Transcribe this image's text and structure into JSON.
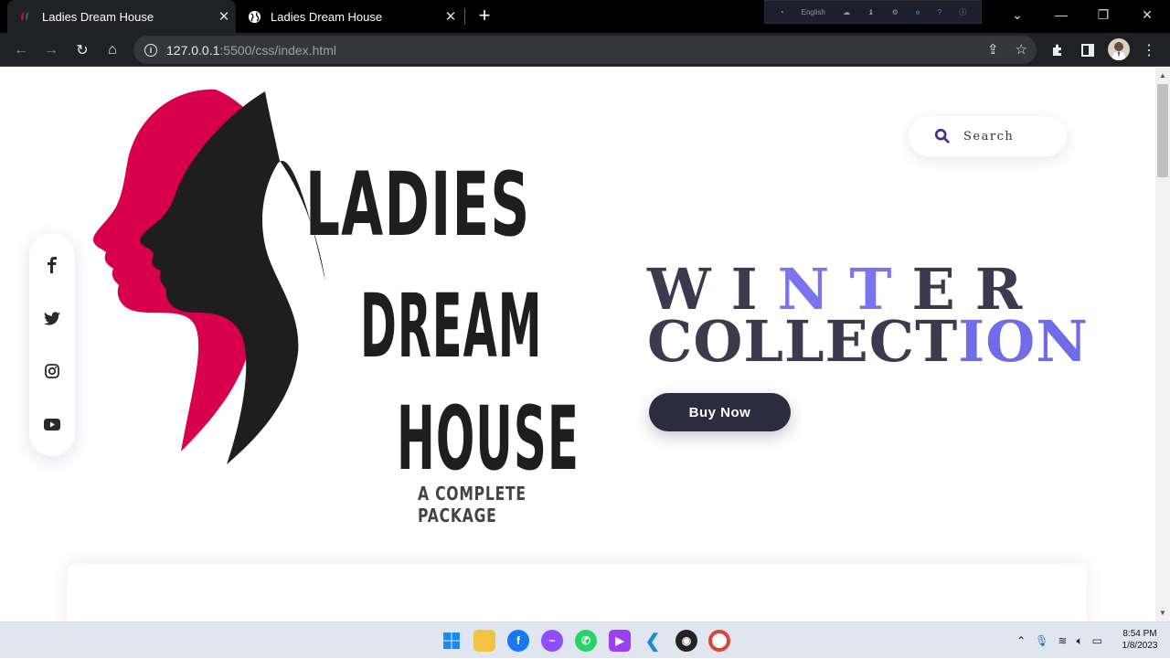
{
  "browser": {
    "tabs": [
      {
        "title": "Ladies Dream House",
        "active": true,
        "favicon": "site-logo-icon"
      },
      {
        "title": "Ladies Dream House",
        "active": false,
        "favicon": "globe-icon"
      }
    ],
    "new_tab": "+",
    "ext_strip_label": "English",
    "url_host": "127.0.0.1",
    "url_path": ":5500/css/index.html"
  },
  "site": {
    "logo": {
      "line1": "LADIES",
      "line2": "DREAM",
      "line3": "HOUSE",
      "tagline": "A COMPLETE PACKAGE",
      "colors": {
        "pink": "#d8004d",
        "black": "#1e1e1e"
      }
    },
    "search": {
      "placeholder": "Search"
    },
    "social": [
      {
        "name": "facebook-icon"
      },
      {
        "name": "twitter-icon"
      },
      {
        "name": "instagram-icon"
      },
      {
        "name": "youtube-icon"
      }
    ],
    "hero": {
      "winter_plain1": "WI",
      "winter_hl": "NT",
      "winter_plain2": "ER",
      "collection_plain": "COLLECT",
      "collection_hl": "ION",
      "button": "Buy Now",
      "colors": {
        "dark": "#3b3a4f",
        "accent": "#7b74f0",
        "button_bg": "#2d2c3e"
      }
    }
  },
  "taskbar": {
    "time": "8:54 PM",
    "date": "1/8/2023"
  }
}
